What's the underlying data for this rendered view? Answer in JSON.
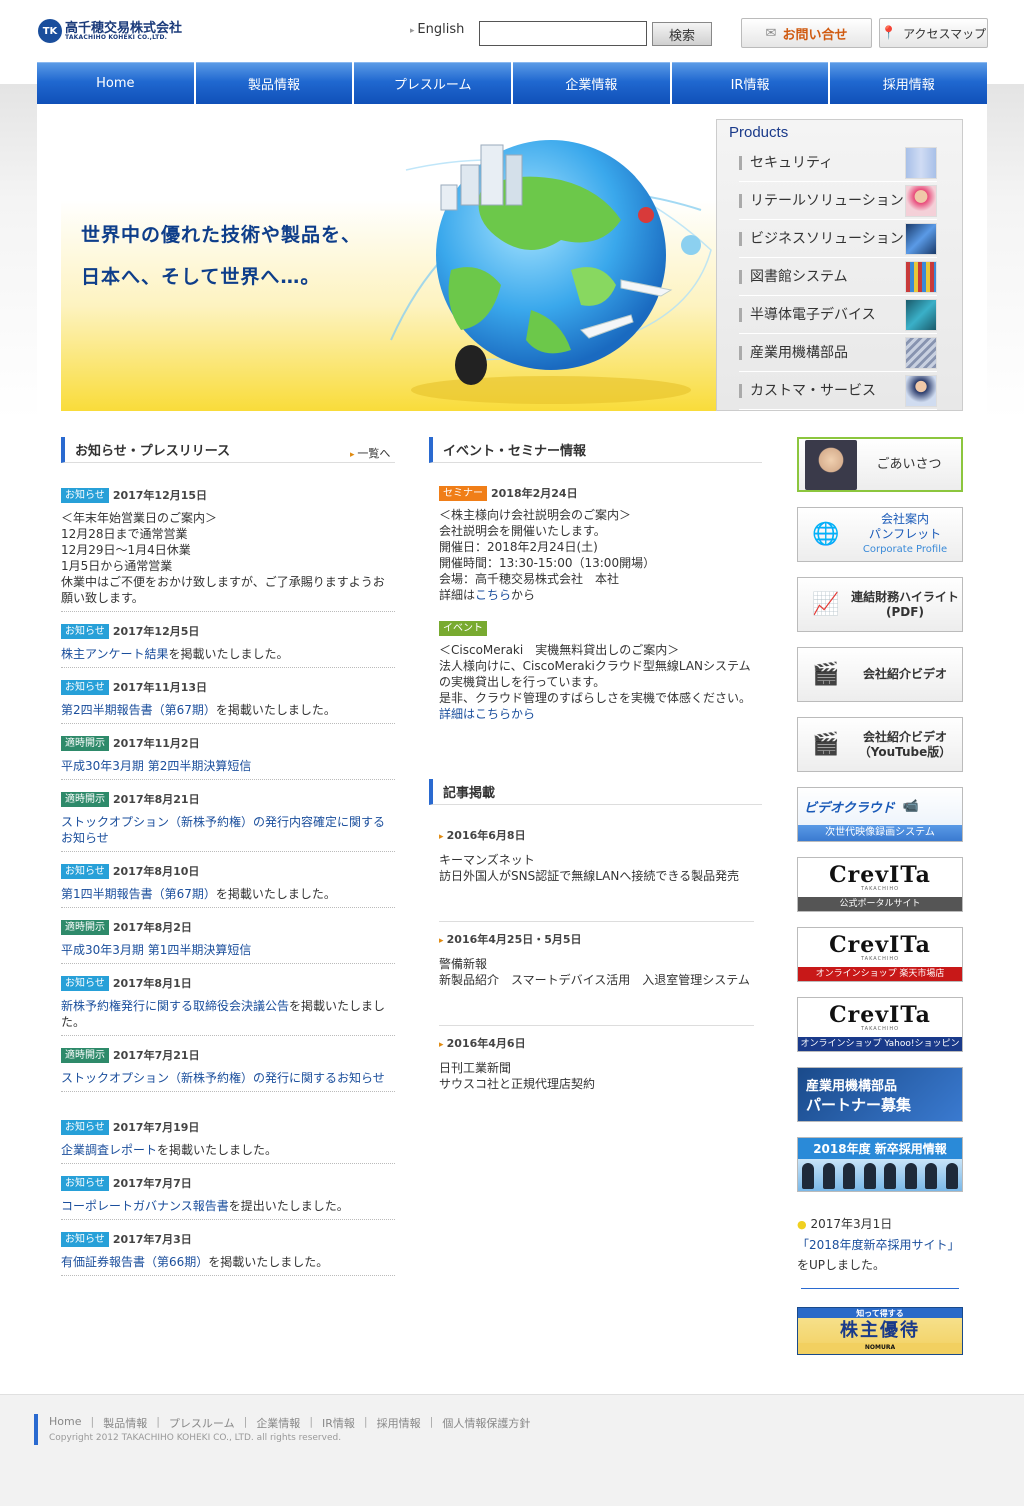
{
  "header": {
    "logo_mark": "TK",
    "logo_jp": "高千穂交易株式会社",
    "logo_en": "TAKACHIHO KOHEKI CO.,LTD.",
    "english_link": "English",
    "search_placeholder": "",
    "search_button": "検索",
    "contact_button": "お問い合せ",
    "access_button": "アクセスマップ"
  },
  "nav": [
    "Home",
    "製品情報",
    "プレスルーム",
    "企業情報",
    "IR情報",
    "採用情報"
  ],
  "hero": {
    "tagline1": "世界中の優れた技術や製品を、",
    "tagline2": "日本へ、そして世界へ…。"
  },
  "products": {
    "title": "Products",
    "items": [
      "セキュリティ",
      "リテールソリューション",
      "ビジネスソリューション",
      "図書館システム",
      "半導体電子デバイス",
      "産業用機構部品",
      "カストマ・サービス"
    ]
  },
  "news": {
    "title": "お知らせ・プレスリリース",
    "more": "一覧へ",
    "items": [
      {
        "badge": "お知らせ",
        "date": "2017年12月15日",
        "text": "＜年末年始営業日のご案内＞\n12月28日まで通常営業\n12月29日～1月4日休業\n1月5日から通常営業\n休業中はご不便をおかけ致しますが、ご了承賜りますようお願い致します。"
      },
      {
        "badge": "お知らせ",
        "date": "2017年12月5日",
        "link": "株主アンケート結果",
        "tail": "を掲載いたしました。"
      },
      {
        "badge": "お知らせ",
        "date": "2017年11月13日",
        "link": "第2四半期報告書（第67期）",
        "tail": "を掲載いたしました。"
      },
      {
        "badge": "適時開示",
        "date": "2017年11月2日",
        "link": "平成30年3月期 第2四半期決算短信",
        "tail": ""
      },
      {
        "badge": "適時開示",
        "date": "2017年8月21日",
        "link": "ストックオプション（新株予約権）の発行内容確定に関するお知らせ",
        "tail": ""
      },
      {
        "badge": "お知らせ",
        "date": "2017年8月10日",
        "link": "第1四半期報告書（第67期）",
        "tail": "を掲載いたしました。"
      },
      {
        "badge": "適時開示",
        "date": "2017年8月2日",
        "link": "平成30年3月期 第1四半期決算短信",
        "tail": ""
      },
      {
        "badge": "お知らせ",
        "date": "2017年8月1日",
        "link": "新株予約権発行に関する取締役会決議公告",
        "tail": "を掲載いたしました。"
      },
      {
        "badge": "適時開示",
        "date": "2017年7月21日",
        "link": "ストックオプション（新株予約権）の発行に関するお知らせ",
        "tail": ""
      },
      {
        "badge": "お知らせ",
        "date": "2017年7月19日",
        "link": "企業調査レポート",
        "tail": "を掲載いたしました。"
      },
      {
        "badge": "お知らせ",
        "date": "2017年7月7日",
        "link": "コーポレートガバナンス報告書",
        "tail": "を提出いたしました。"
      },
      {
        "badge": "お知らせ",
        "date": "2017年7月3日",
        "link": "有価証券報告書（第66期）",
        "tail": "を掲載いたしました。"
      }
    ]
  },
  "events": {
    "title": "イベント・セミナー情報",
    "items": [
      {
        "badge": "セミナー",
        "date": "2018年2月24日",
        "text": "＜株主様向け会社説明会のご案内＞\n会社説明会を開催いたします。\n開催日：2018年2月24日(土)\n開催時間：13:30-15:00（13:00開場）\n会場：高千穂交易株式会社　本社\n",
        "pre_link": "詳細は",
        "link": "こちら",
        "post_link": "から"
      },
      {
        "badge": "イベント",
        "date": "",
        "text": "＜CiscoMeraki　実機無料貸出しのご案内＞\n法人様向けに、CiscoMerakiクラウド型無線LANシステムの実機貸出しを行っています。\n是非、クラウド管理のすばらしさを実機で体感ください。\n",
        "pre_link": "",
        "link": "詳細はこちらから",
        "post_link": ""
      }
    ]
  },
  "articles": {
    "title": "記事掲載",
    "items": [
      {
        "date": "2016年6月8日",
        "text": "キーマンズネット\n訪日外国人がSNS認証で無線LANへ接続できる製品発売"
      },
      {
        "date": "2016年4月25日・5月5日",
        "text": "警備新報\n新製品紹介　スマートデバイス活用　入退室管理システム"
      },
      {
        "date": "2016年4月6日",
        "text": "日刊工業新聞\nサウスコ社と正規代理店契約"
      }
    ]
  },
  "sidebar": {
    "greeting": "ごあいさつ",
    "brochure1": "会社案内",
    "brochure2": "パンフレット",
    "brochure_en": "Corporate Profile",
    "financial1": "連結財務ハイライト",
    "financial2": "(PDF)",
    "video": "会社紹介ビデオ",
    "video_yt1": "会社紹介ビデオ",
    "video_yt2": "（YouTube版）",
    "videocloud": "ビデオクラウド",
    "videocloud_sub": "次世代映像録画システム",
    "crevita_logo": "CrevITa",
    "crevita_small": "TAKACHIHO",
    "crevita_portal": "公式ポータルサイト",
    "crevita_rakuten": "オンラインショップ 楽天市場店",
    "crevita_yahoo": "オンラインショップ Yahoo!ショッピング店",
    "partner1": "産業用機構部品",
    "partner2": "パートナー募集",
    "recruit": "2018年度 新卒採用情報",
    "recruit_news_date": "2017年3月1日",
    "recruit_news_link": "「2018年度新卒採用サイト」",
    "recruit_news_tail": "をUPしました。",
    "yutai_top": "知って得する",
    "yutai_main": "株主優待",
    "yutai_bottom": "NOMURA"
  },
  "footer": {
    "links": [
      "Home",
      "製品情報",
      "プレスルーム",
      "企業情報",
      "IR情報",
      "採用情報",
      "個人情報保護方針"
    ],
    "copyright": "Copyright 2012 TAKACHIHO KOHEKI CO., LTD. all rights reserved."
  },
  "colors": {
    "nav_blue": "#2068d0",
    "title_navy": "#0e3e8a",
    "link_blue": "#1a4e9c",
    "notice_badge": "#27a0d8",
    "disclosure_badge": "#2e8a6a",
    "seminar_badge": "#f07e18",
    "event_badge": "#78aa30"
  }
}
